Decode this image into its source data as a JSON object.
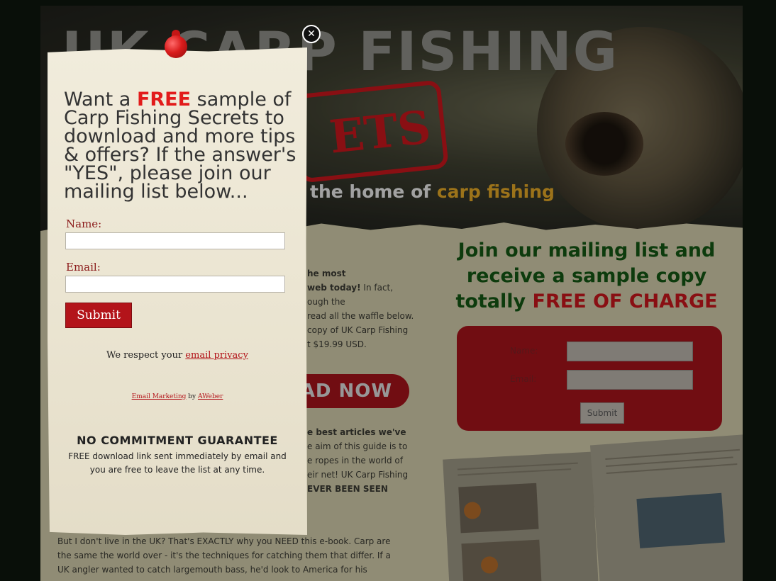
{
  "site": {
    "hero_title": "UK CARP FISHING",
    "stamp_text": "ETS",
    "tagline_prefix": "the home of ",
    "tagline_highlight": "carp fishing",
    "body_para1_bold1": "he most",
    "body_para1_bold2": "web today!",
    "body_para1_rest": " In fact,",
    "body_line3": "ough the",
    "body_line4": "read all the waffle below.",
    "body_line5": "copy of UK Carp Fishing",
    "body_line6": "t $19.99 USD.",
    "download_button": "OAD NOW",
    "body_para2_bold": "e best articles we've",
    "body_para2_line2": "e aim of this guide is to",
    "body_para2_line3": "e ropes in the world of",
    "body_para2_line4": "eir net! UK Carp Fishing",
    "body_para2_line5_bold": "EVER BEEN SEEN",
    "body_para3_line1": "But I don't live in the UK? That's EXACTLY why you NEED this e-book. Carp are",
    "body_para3_line2": "the same the world over - it's the techniques for catching them that differ. If a",
    "body_para3_line3": "UK angler wanted to catch largemouth bass, he'd look to America for his",
    "promo_line1": "Join our mailing list and",
    "promo_line2": "receive a sample copy",
    "promo_line3_prefix": "totally ",
    "promo_line3_red": "FREE OF CHARGE",
    "signup_name_label": "Name:",
    "signup_email_label": "Email:",
    "signup_submit": "Submit"
  },
  "popup": {
    "close_glyph": "✕",
    "heading_prefix": "Want a ",
    "heading_free": "FREE",
    "heading_rest": " sample of Carp Fishing Secrets to download and more tips & offers? If the answer's \"YES\", please join our mailing list below...",
    "name_label": "Name:",
    "name_value": "",
    "email_label": "Email:",
    "email_value": "",
    "submit_label": "Submit",
    "privacy_prefix": "We respect your ",
    "privacy_link": "email privacy",
    "aweber_link1": "Email Marketing",
    "aweber_by": " by ",
    "aweber_link2": "AWeber",
    "guarantee_title": "NO COMMITMENT GUARANTEE",
    "guarantee_text": "FREE download link sent immediately by email and you are free to leave the list at any time."
  },
  "colors": {
    "accent_red": "#b3141a",
    "free_red": "#e21b1b",
    "promo_green": "#145514",
    "highlight_orange": "#e0a526"
  },
  "icons": {
    "close": "close-icon",
    "pin": "pushpin-icon"
  }
}
